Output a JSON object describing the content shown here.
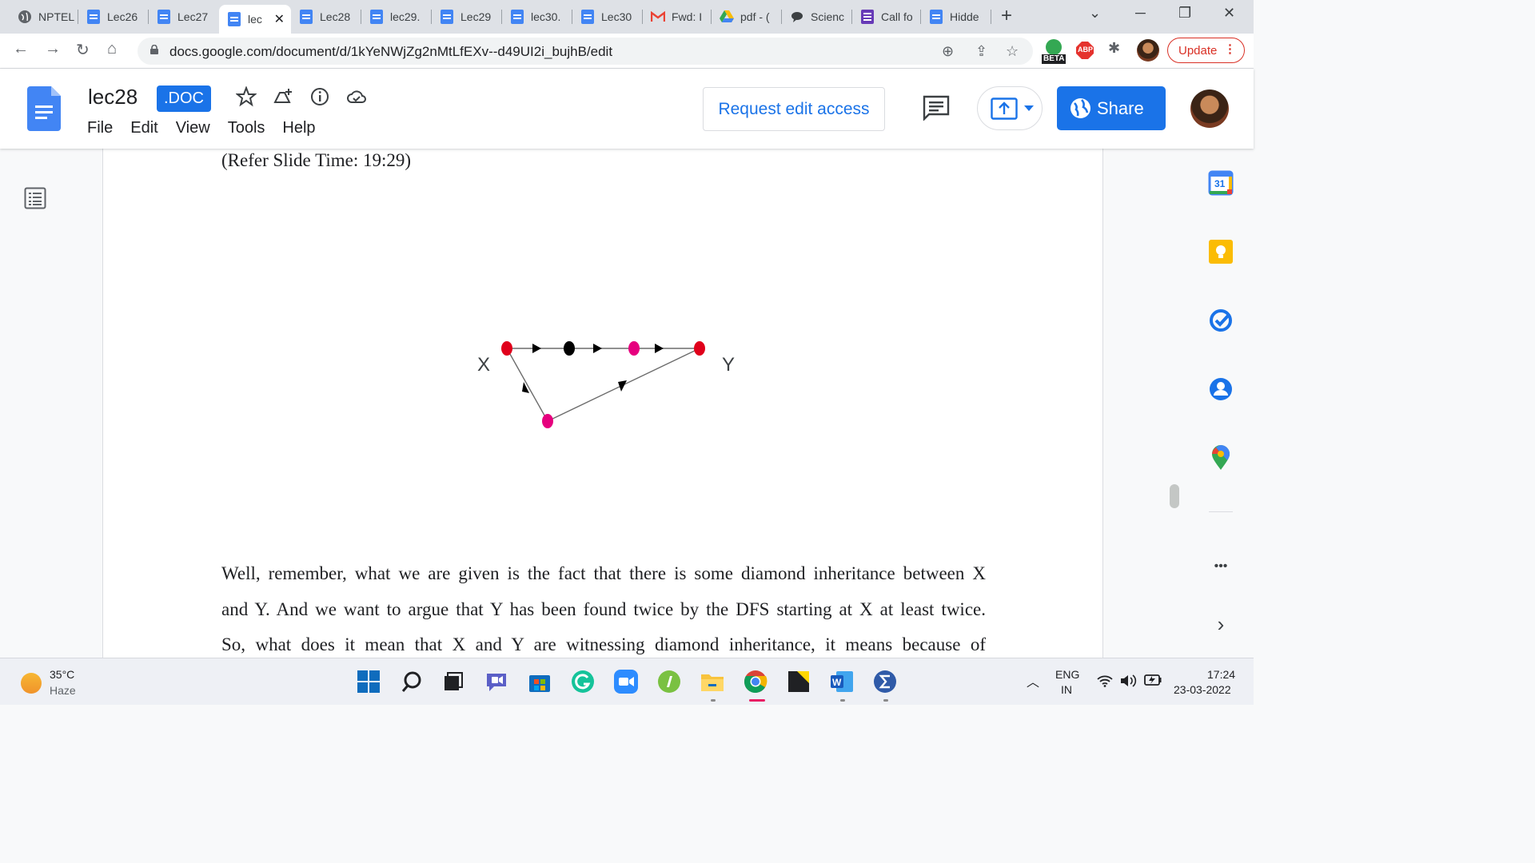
{
  "browser": {
    "tabs": [
      {
        "label": "NPTEL",
        "icon": "globe-icon"
      },
      {
        "label": "Lec26",
        "icon": "docs-icon"
      },
      {
        "label": "Lec27",
        "icon": "docs-icon"
      },
      {
        "label": "lec",
        "icon": "docs-icon",
        "active": true
      },
      {
        "label": "Lec28",
        "icon": "docs-icon"
      },
      {
        "label": "lec29.",
        "icon": "docs-icon"
      },
      {
        "label": "Lec29",
        "icon": "docs-icon"
      },
      {
        "label": "lec30.",
        "icon": "docs-icon"
      },
      {
        "label": "Lec30",
        "icon": "docs-icon"
      },
      {
        "label": "Fwd: I",
        "icon": "gmail-icon"
      },
      {
        "label": "pdf - (",
        "icon": "drive-icon"
      },
      {
        "label": "Scienc",
        "icon": "chat-icon"
      },
      {
        "label": "Call fo",
        "icon": "forms-icon"
      },
      {
        "label": "Hidde",
        "icon": "docs-icon"
      }
    ],
    "url": "docs.google.com/document/d/1kYeNWjZg2nMtLfEXv--d49UI2i_bujhB/edit",
    "beta_badge": "BETA",
    "abp_badge": "ABP",
    "update_label": "Update"
  },
  "doc": {
    "title": "lec28",
    "badge": ".DOC",
    "menu": [
      "File",
      "Edit",
      "View",
      "Tools",
      "Help"
    ],
    "request_edit_label": "Request edit access",
    "share_label": "Share"
  },
  "content": {
    "slide_time": "(Refer Slide Time: 19:29)",
    "diagram": {
      "label_x": "X",
      "label_y": "Y"
    },
    "paragraph_lines": [
      "Well, remember, what we are given is the fact that there is some diamond inheritance between X",
      "and Y. And we want to argue that Y has been found twice by the DFS starting at X at least twice.",
      "So, what does it mean that X and Y are witnessing diamond inheritance, it means because of"
    ]
  },
  "sidepanel": {
    "calendar_day": "31",
    "more_label": "•••"
  },
  "taskbar": {
    "temperature": "35°C",
    "condition": "Haze",
    "lang_top": "ENG",
    "lang_bottom": "IN",
    "time": "17:24",
    "date": "23-03-2022"
  },
  "colors": {
    "accent": "#1a73e8",
    "red_node": "#e0001b",
    "pink_node": "#e6007e",
    "update_red": "#d93025"
  }
}
